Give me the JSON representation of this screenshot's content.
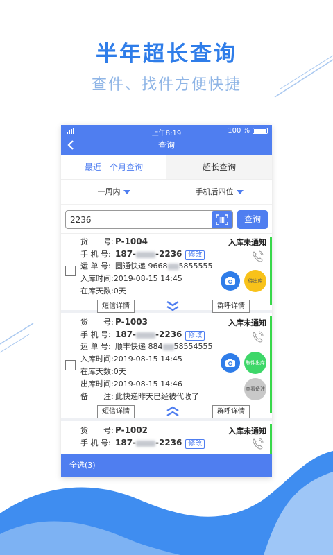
{
  "promo": {
    "headline": "半年超长查询",
    "subline": "查件、找件方便快捷"
  },
  "status_bar": {
    "time": "上午8:19",
    "battery": "100 %"
  },
  "nav": {
    "title": "查询",
    "back_icon": "chevron-left-icon"
  },
  "tabs": [
    {
      "label": "最近一个月查询",
      "active": false
    },
    {
      "label": "超长查询",
      "active": true
    }
  ],
  "filters": {
    "range": "一周内",
    "field": "手机后四位"
  },
  "search": {
    "value": "2236",
    "button": "查询"
  },
  "labels": {
    "goods_no": "货　　号:",
    "phone": "手 机 号:",
    "waybill": "运 单 号:",
    "in_time": "入库时间:",
    "days": "在库天数:",
    "out_time": "出库时间:",
    "remark": "备　　注:",
    "edit": "修改",
    "sms": "短信详情",
    "group_call": "群呼详情"
  },
  "items": [
    {
      "goods_no": "P-1004",
      "phone_prefix": "187-",
      "phone_suffix": "-2236",
      "status": "入库未通知",
      "waybill_prefix": "圆通快递 9668",
      "waybill_suffix": "5855555",
      "in_time": "2019-08-15 14:45",
      "days": "0天",
      "action": "待出库"
    },
    {
      "goods_no": "P-1003",
      "phone_prefix": "187-",
      "phone_suffix": "-2236",
      "status": "入库未通知",
      "waybill_prefix": "顺丰快递 884",
      "waybill_suffix": "58554555",
      "in_time": "2019-08-15 14:45",
      "days": "0天",
      "out_time": "2019-08-15 14:46",
      "remark": "此快递昨天已经被代收了",
      "action": "取件出库",
      "action2": "查看备注"
    },
    {
      "goods_no": "P-1002",
      "phone_prefix": "187-",
      "phone_suffix": "-2236",
      "status": "入库未通知"
    }
  ],
  "footer": {
    "select_all": "全选(3)"
  },
  "colors": {
    "primary": "#4f7ef0",
    "accent_green": "#38d84a",
    "action_yellow": "#f8c21a",
    "action_green": "#3ed769",
    "headline": "#2f7de9"
  }
}
